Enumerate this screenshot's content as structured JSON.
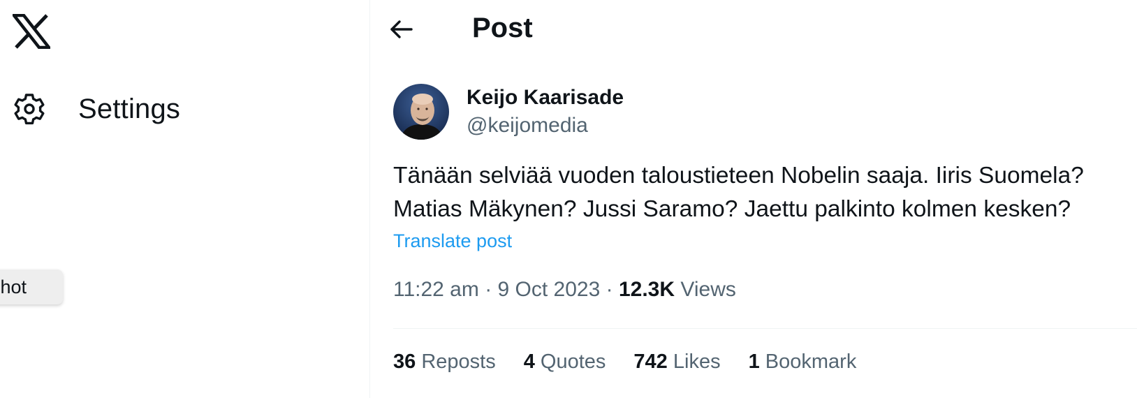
{
  "sidebar": {
    "logo_icon": "x-logo-icon",
    "settings": {
      "icon": "gear-icon",
      "label": "Settings"
    },
    "tooltip_text": "nshot"
  },
  "header": {
    "back_icon": "arrow-left-icon",
    "title": "Post"
  },
  "post": {
    "author": {
      "display_name": "Keijo Kaarisade",
      "handle": "@keijomedia",
      "avatar": "avatar-photo"
    },
    "text": "Tänään selviää vuoden taloustieteen Nobelin saaja. Iiris Suomela?\nMatias Mäkynen? Jussi Saramo? Jaettu palkinto kolmen kesken?",
    "translate_label": "Translate post",
    "time": "11:22 am",
    "separator": " · ",
    "date": "9 Oct 2023",
    "views_count": "12.3K",
    "views_label": "Views"
  },
  "stats": {
    "reposts_count": "36",
    "reposts_label": "Reposts",
    "quotes_count": "4",
    "quotes_label": "Quotes",
    "likes_count": "742",
    "likes_label": "Likes",
    "bookmarks_count": "1",
    "bookmarks_label": "Bookmark"
  },
  "colors": {
    "text_primary": "#0f1419",
    "text_secondary": "#536471",
    "link": "#1d9bf0",
    "divider": "#eff3f4"
  }
}
